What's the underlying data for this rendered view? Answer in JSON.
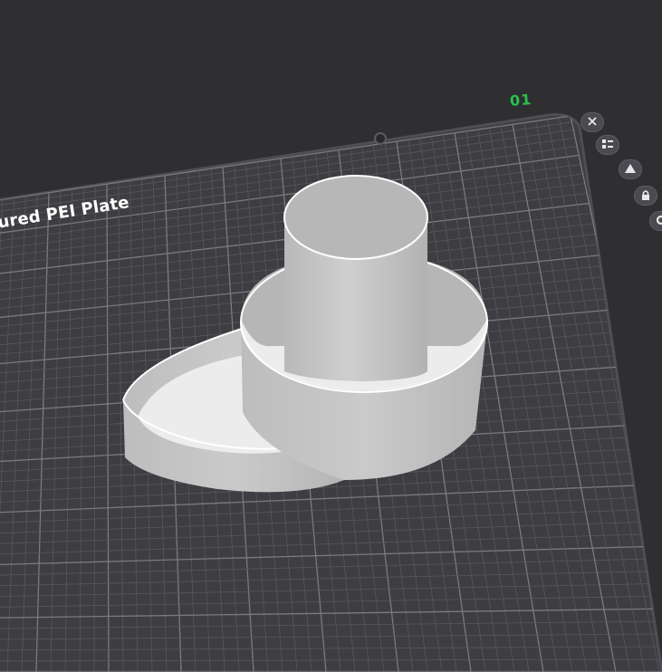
{
  "plate": {
    "label": "ured PEI Plate",
    "number": "01",
    "number_color": "#27c24c"
  },
  "colors": {
    "background": "#2f2f32",
    "plate_surface": "#3d3d42",
    "plate_edge": "#4e4e54",
    "grid_minor": "#57575d",
    "grid_major": "#7a7a80",
    "model_body": "#c4c4c4",
    "model_inner": "#ececec",
    "model_edge": "#ffffff"
  },
  "plate_buttons": [
    {
      "name": "close-plate-icon"
    },
    {
      "name": "arrange-icon"
    },
    {
      "name": "auto-orient-icon"
    },
    {
      "name": "lock-plate-icon"
    },
    {
      "name": "plate-settings-icon"
    }
  ]
}
